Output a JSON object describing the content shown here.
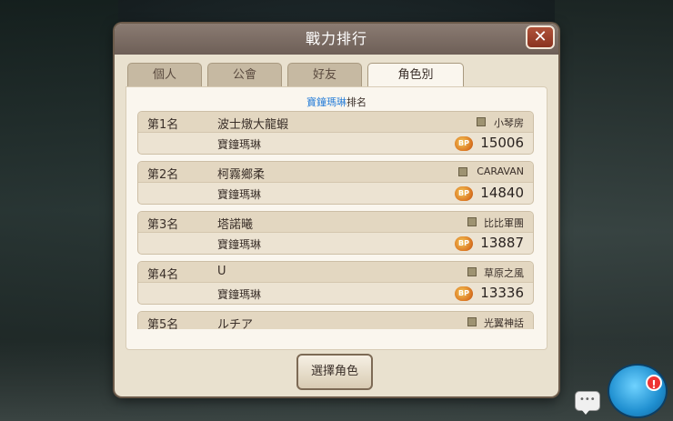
{
  "dialog": {
    "title": "戰力排行",
    "close_label": "✕"
  },
  "tabs": [
    {
      "label": "個人",
      "active": false
    },
    {
      "label": "公會",
      "active": false
    },
    {
      "label": "好友",
      "active": false
    },
    {
      "label": "角色別",
      "active": true
    }
  ],
  "subtitle": {
    "character": "寶鐘瑪琳",
    "suffix": "排名"
  },
  "rankings": [
    {
      "rank": "第1名",
      "player": "波士燉大龍蝦",
      "guild": "小琴房",
      "character": "寶鐘瑪琳",
      "bp_icon": "BP",
      "bp": "15006"
    },
    {
      "rank": "第2名",
      "player": "柯霧鄉柔",
      "guild": "CARAVAN",
      "character": "寶鐘瑪琳",
      "bp_icon": "BP",
      "bp": "14840"
    },
    {
      "rank": "第3名",
      "player": "塔諾曦",
      "guild": "比比軍團",
      "character": "寶鐘瑪琳",
      "bp_icon": "BP",
      "bp": "13887"
    },
    {
      "rank": "第4名",
      "player": "U",
      "guild": "草原之風",
      "character": "寶鐘瑪琳",
      "bp_icon": "BP",
      "bp": "13336"
    },
    {
      "rank": "第5名",
      "player": "ルチア",
      "guild": "光翼神話",
      "character": "",
      "bp_icon": "",
      "bp": ""
    }
  ],
  "buttons": {
    "select_character": "選擇角色"
  },
  "hud": {
    "chat_dots": "•••",
    "alert": "!"
  }
}
